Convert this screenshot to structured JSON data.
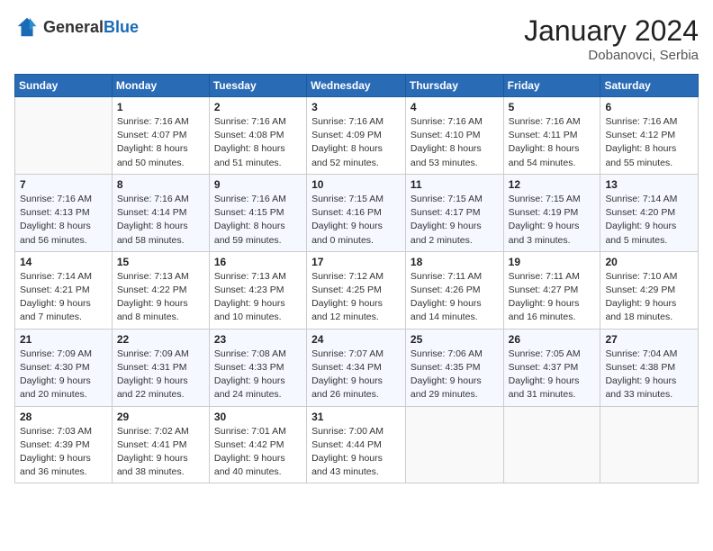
{
  "header": {
    "logo_general": "General",
    "logo_blue": "Blue",
    "month_year": "January 2024",
    "location": "Dobanovci, Serbia"
  },
  "days_of_week": [
    "Sunday",
    "Monday",
    "Tuesday",
    "Wednesday",
    "Thursday",
    "Friday",
    "Saturday"
  ],
  "weeks": [
    [
      {
        "day": "",
        "sunrise": "",
        "sunset": "",
        "daylight": ""
      },
      {
        "day": "1",
        "sunrise": "Sunrise: 7:16 AM",
        "sunset": "Sunset: 4:07 PM",
        "daylight": "Daylight: 8 hours and 50 minutes."
      },
      {
        "day": "2",
        "sunrise": "Sunrise: 7:16 AM",
        "sunset": "Sunset: 4:08 PM",
        "daylight": "Daylight: 8 hours and 51 minutes."
      },
      {
        "day": "3",
        "sunrise": "Sunrise: 7:16 AM",
        "sunset": "Sunset: 4:09 PM",
        "daylight": "Daylight: 8 hours and 52 minutes."
      },
      {
        "day": "4",
        "sunrise": "Sunrise: 7:16 AM",
        "sunset": "Sunset: 4:10 PM",
        "daylight": "Daylight: 8 hours and 53 minutes."
      },
      {
        "day": "5",
        "sunrise": "Sunrise: 7:16 AM",
        "sunset": "Sunset: 4:11 PM",
        "daylight": "Daylight: 8 hours and 54 minutes."
      },
      {
        "day": "6",
        "sunrise": "Sunrise: 7:16 AM",
        "sunset": "Sunset: 4:12 PM",
        "daylight": "Daylight: 8 hours and 55 minutes."
      }
    ],
    [
      {
        "day": "7",
        "sunrise": "Sunrise: 7:16 AM",
        "sunset": "Sunset: 4:13 PM",
        "daylight": "Daylight: 8 hours and 56 minutes."
      },
      {
        "day": "8",
        "sunrise": "Sunrise: 7:16 AM",
        "sunset": "Sunset: 4:14 PM",
        "daylight": "Daylight: 8 hours and 58 minutes."
      },
      {
        "day": "9",
        "sunrise": "Sunrise: 7:16 AM",
        "sunset": "Sunset: 4:15 PM",
        "daylight": "Daylight: 8 hours and 59 minutes."
      },
      {
        "day": "10",
        "sunrise": "Sunrise: 7:15 AM",
        "sunset": "Sunset: 4:16 PM",
        "daylight": "Daylight: 9 hours and 0 minutes."
      },
      {
        "day": "11",
        "sunrise": "Sunrise: 7:15 AM",
        "sunset": "Sunset: 4:17 PM",
        "daylight": "Daylight: 9 hours and 2 minutes."
      },
      {
        "day": "12",
        "sunrise": "Sunrise: 7:15 AM",
        "sunset": "Sunset: 4:19 PM",
        "daylight": "Daylight: 9 hours and 3 minutes."
      },
      {
        "day": "13",
        "sunrise": "Sunrise: 7:14 AM",
        "sunset": "Sunset: 4:20 PM",
        "daylight": "Daylight: 9 hours and 5 minutes."
      }
    ],
    [
      {
        "day": "14",
        "sunrise": "Sunrise: 7:14 AM",
        "sunset": "Sunset: 4:21 PM",
        "daylight": "Daylight: 9 hours and 7 minutes."
      },
      {
        "day": "15",
        "sunrise": "Sunrise: 7:13 AM",
        "sunset": "Sunset: 4:22 PM",
        "daylight": "Daylight: 9 hours and 8 minutes."
      },
      {
        "day": "16",
        "sunrise": "Sunrise: 7:13 AM",
        "sunset": "Sunset: 4:23 PM",
        "daylight": "Daylight: 9 hours and 10 minutes."
      },
      {
        "day": "17",
        "sunrise": "Sunrise: 7:12 AM",
        "sunset": "Sunset: 4:25 PM",
        "daylight": "Daylight: 9 hours and 12 minutes."
      },
      {
        "day": "18",
        "sunrise": "Sunrise: 7:11 AM",
        "sunset": "Sunset: 4:26 PM",
        "daylight": "Daylight: 9 hours and 14 minutes."
      },
      {
        "day": "19",
        "sunrise": "Sunrise: 7:11 AM",
        "sunset": "Sunset: 4:27 PM",
        "daylight": "Daylight: 9 hours and 16 minutes."
      },
      {
        "day": "20",
        "sunrise": "Sunrise: 7:10 AM",
        "sunset": "Sunset: 4:29 PM",
        "daylight": "Daylight: 9 hours and 18 minutes."
      }
    ],
    [
      {
        "day": "21",
        "sunrise": "Sunrise: 7:09 AM",
        "sunset": "Sunset: 4:30 PM",
        "daylight": "Daylight: 9 hours and 20 minutes."
      },
      {
        "day": "22",
        "sunrise": "Sunrise: 7:09 AM",
        "sunset": "Sunset: 4:31 PM",
        "daylight": "Daylight: 9 hours and 22 minutes."
      },
      {
        "day": "23",
        "sunrise": "Sunrise: 7:08 AM",
        "sunset": "Sunset: 4:33 PM",
        "daylight": "Daylight: 9 hours and 24 minutes."
      },
      {
        "day": "24",
        "sunrise": "Sunrise: 7:07 AM",
        "sunset": "Sunset: 4:34 PM",
        "daylight": "Daylight: 9 hours and 26 minutes."
      },
      {
        "day": "25",
        "sunrise": "Sunrise: 7:06 AM",
        "sunset": "Sunset: 4:35 PM",
        "daylight": "Daylight: 9 hours and 29 minutes."
      },
      {
        "day": "26",
        "sunrise": "Sunrise: 7:05 AM",
        "sunset": "Sunset: 4:37 PM",
        "daylight": "Daylight: 9 hours and 31 minutes."
      },
      {
        "day": "27",
        "sunrise": "Sunrise: 7:04 AM",
        "sunset": "Sunset: 4:38 PM",
        "daylight": "Daylight: 9 hours and 33 minutes."
      }
    ],
    [
      {
        "day": "28",
        "sunrise": "Sunrise: 7:03 AM",
        "sunset": "Sunset: 4:39 PM",
        "daylight": "Daylight: 9 hours and 36 minutes."
      },
      {
        "day": "29",
        "sunrise": "Sunrise: 7:02 AM",
        "sunset": "Sunset: 4:41 PM",
        "daylight": "Daylight: 9 hours and 38 minutes."
      },
      {
        "day": "30",
        "sunrise": "Sunrise: 7:01 AM",
        "sunset": "Sunset: 4:42 PM",
        "daylight": "Daylight: 9 hours and 40 minutes."
      },
      {
        "day": "31",
        "sunrise": "Sunrise: 7:00 AM",
        "sunset": "Sunset: 4:44 PM",
        "daylight": "Daylight: 9 hours and 43 minutes."
      },
      {
        "day": "",
        "sunrise": "",
        "sunset": "",
        "daylight": ""
      },
      {
        "day": "",
        "sunrise": "",
        "sunset": "",
        "daylight": ""
      },
      {
        "day": "",
        "sunrise": "",
        "sunset": "",
        "daylight": ""
      }
    ]
  ]
}
